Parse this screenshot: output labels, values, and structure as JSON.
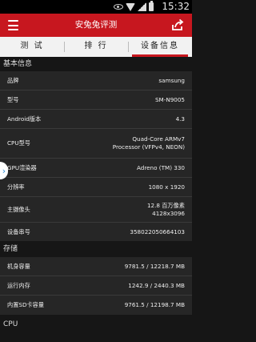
{
  "status_bar": {
    "time": "15:32"
  },
  "app_bar": {
    "title": "安兔兔评测"
  },
  "tabs": [
    {
      "label": "测 试"
    },
    {
      "label": "排 行"
    },
    {
      "label": "设备信息"
    }
  ],
  "sections": {
    "basic": {
      "header": "基本信息",
      "rows": [
        {
          "label": "品牌",
          "value": "samsung"
        },
        {
          "label": "型号",
          "value": "SM-N9005"
        },
        {
          "label": "Android版本",
          "value": "4.3"
        },
        {
          "label": "CPU型号",
          "value_line1": "Quad-Core ARMv7",
          "value_line2": "Processor (VFPv4, NEON)"
        },
        {
          "label": "GPU渲染器",
          "value": "Adreno (TM) 330"
        },
        {
          "label": "分辨率",
          "value": "1080 x 1920"
        },
        {
          "label": "主摄像头",
          "value_line1": "12.8 百万像素",
          "value_line2": "4128x3096"
        },
        {
          "label": "设备串号",
          "value": "358022050664103"
        }
      ]
    },
    "storage": {
      "header": "存储",
      "rows": [
        {
          "label": "机身容量",
          "value": "9781.5 / 12218.7 MB"
        },
        {
          "label": "运行内存",
          "value": "1242.9 / 2440.3 MB"
        },
        {
          "label": "内置SD卡容量",
          "value": "9761.5 / 12198.7 MB"
        }
      ]
    },
    "cpu": {
      "header": "CPU"
    }
  },
  "colors": {
    "accent": "#c7171f",
    "background": "#161616",
    "card": "#262626"
  }
}
